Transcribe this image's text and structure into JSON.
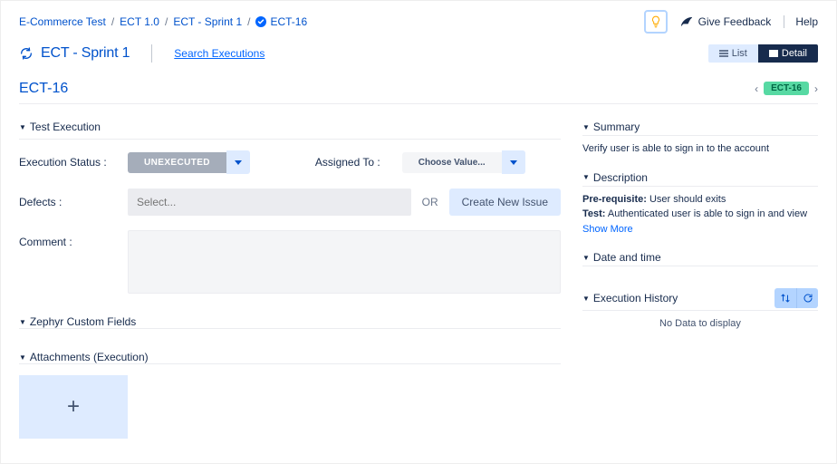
{
  "breadcrumb": {
    "items": [
      "E-Commerce Test",
      "ECT 1.0",
      "ECT - Sprint 1"
    ],
    "current": "ECT-16",
    "sep": "/"
  },
  "topbar": {
    "feedback": "Give Feedback",
    "help": "Help"
  },
  "titlerow": {
    "sprint": "ECT - Sprint 1",
    "search": "Search Executions",
    "list": "List",
    "detail": "Detail"
  },
  "issuekey": {
    "key": "ECT-16",
    "badge": "ECT-16"
  },
  "sections": {
    "testExecution": "Test Execution",
    "zephyrCustom": "Zephyr Custom Fields",
    "attachments": "Attachments (Execution)",
    "summary": "Summary",
    "description": "Description",
    "datetime": "Date and time",
    "history": "Execution History"
  },
  "form": {
    "execStatusLabel": "Execution Status :",
    "execStatusValue": "UNEXECUTED",
    "assignedToLabel": "Assigned To :",
    "assignedToValue": "Choose Value...",
    "defectsLabel": "Defects :",
    "defectsPlaceholder": "Select...",
    "or": "OR",
    "createNewIssue": "Create New Issue",
    "commentLabel": "Comment :",
    "addAttachment": "+"
  },
  "right": {
    "summaryText": "Verify user is able to sign in to the account",
    "prereqLabel": "Pre-requisite:",
    "prereqValue": " User should exits",
    "testLabel": "Test:",
    "testValue": " Authenticated user is able to sign in and view",
    "showMore": "Show More",
    "noData": "No Data to display"
  }
}
